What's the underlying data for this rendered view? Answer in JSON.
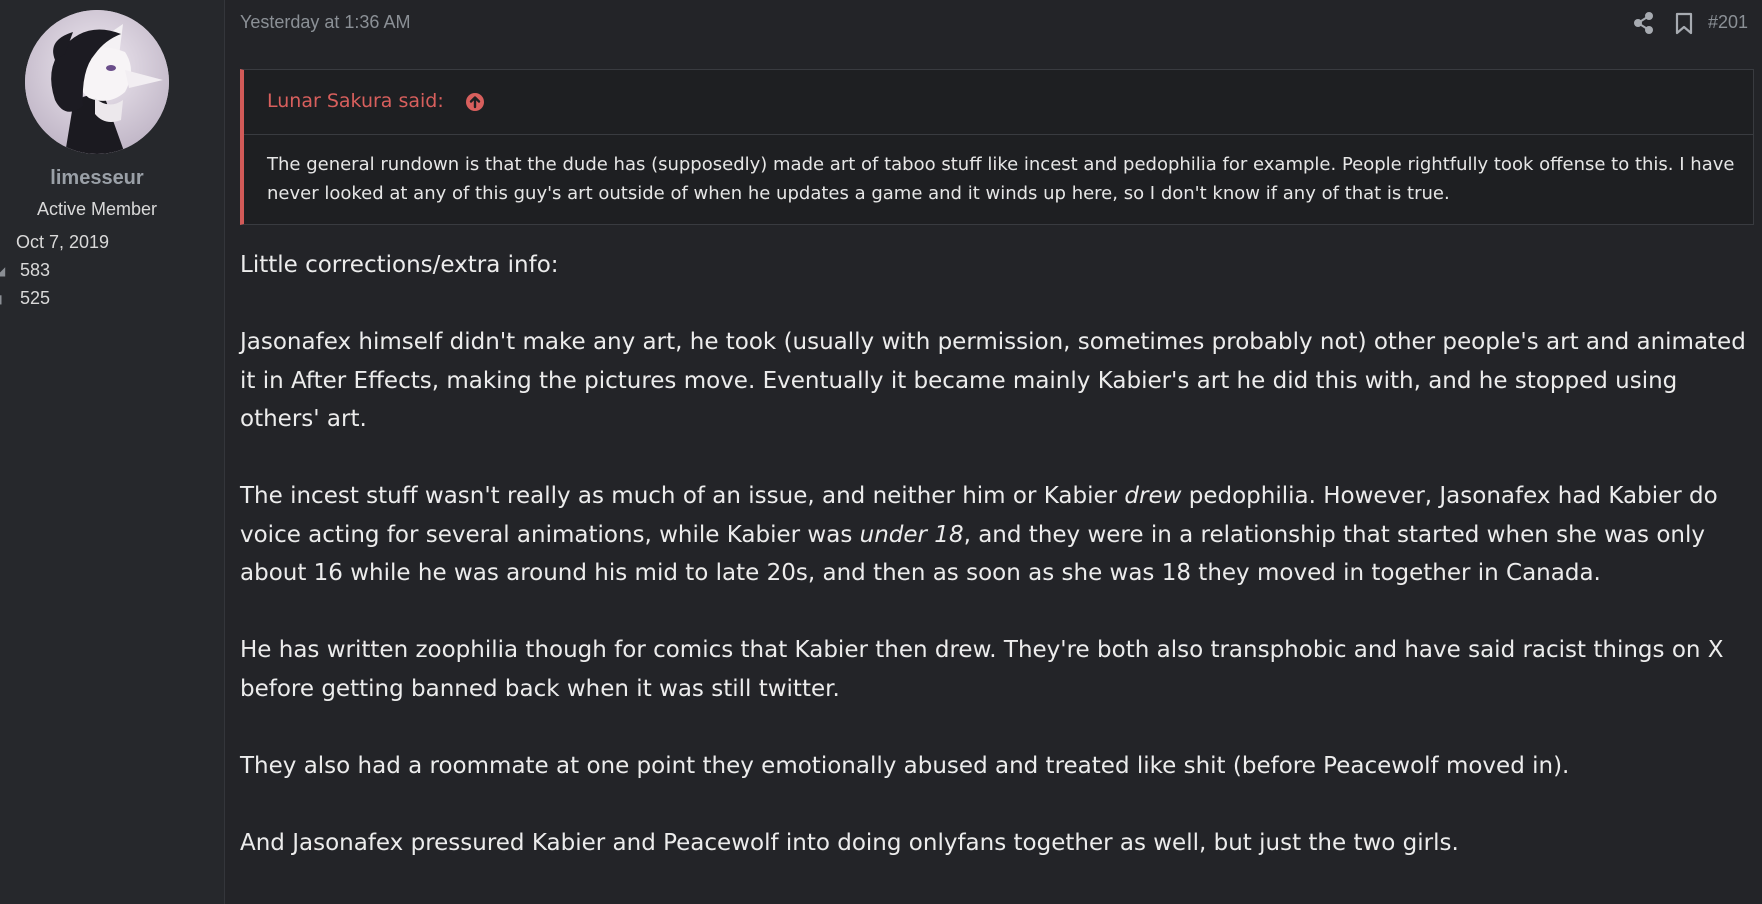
{
  "user": {
    "name": "limesseur",
    "title": "Active Member",
    "stats": [
      {
        "icon": "calendar-icon",
        "value": "Oct 7, 2019"
      },
      {
        "icon": "messages-icon",
        "value": "583"
      },
      {
        "icon": "reactions-icon",
        "value": "525"
      }
    ]
  },
  "post": {
    "date": "Yesterday at 1:36 AM",
    "number": "#201",
    "quote": {
      "author_label": "Lunar Sakura said:",
      "text": "The general rundown is that the dude has (supposedly) made art of taboo stuff like incest and pedophilia for example. People rightfully took offense to this. I have never looked at any of this guy's art outside of when he updates a game and it winds up here, so I don't know if any of that is true."
    },
    "paragraphs": [
      {
        "text": "Little corrections/extra info:"
      },
      {
        "text": "Jasonafex himself didn't make any art, he took (usually with permission, sometimes probably not) other people's art and animated it in After Effects, making the pictures move. Eventually it became mainly Kabier's art he did this with, and he stopped using others' art."
      },
      {
        "p1": "The incest stuff wasn't really as much of an issue, and neither him or Kabier ",
        "em1": "drew",
        "p2": " pedophilia. However, Jasonafex had Kabier do voice acting for several animations, while Kabier was ",
        "em2": "under 18",
        "p3": ", and they were in a relationship that started when she was only about 16 while he was around his mid to late 20s, and then as soon as she was 18 they moved in together in Canada."
      },
      {
        "text": "He has written zoophilia though for comics that Kabier then drew. They're both also transphobic and have said racist things on X before getting banned back when it was still twitter."
      },
      {
        "text": "They also had a roommate at one point they emotionally abused and treated like shit (before Peacewolf moved in)."
      },
      {
        "text": "And Jasonafex pressured Kabier and Peacewolf into doing onlyfans together as well, but just the two girls."
      }
    ]
  },
  "colors": {
    "background": "#232428",
    "sidebar": "#26282c",
    "quote_accent": "#d25a58",
    "muted_text": "#8b9096"
  }
}
